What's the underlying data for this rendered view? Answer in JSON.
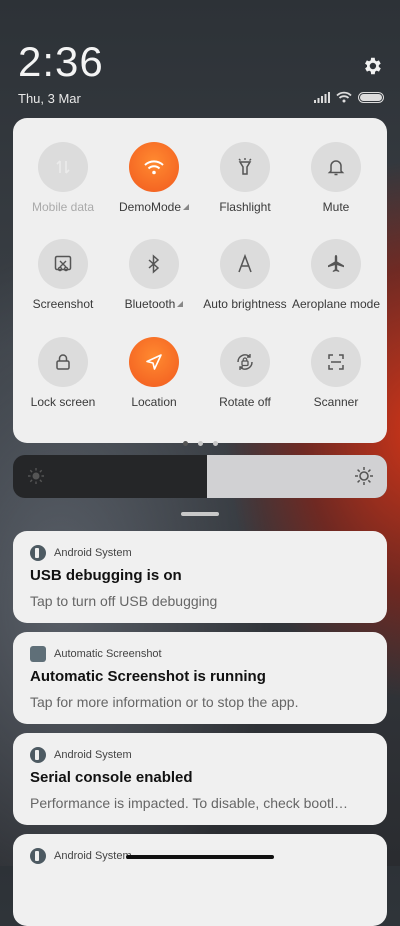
{
  "header": {
    "time": "2:36",
    "date": "Thu, 3 Mar"
  },
  "quick_settings": {
    "tiles": [
      {
        "label": "Mobile data",
        "icon": "mobile-data-icon",
        "state": "disabled"
      },
      {
        "label": "DemoMode",
        "icon": "wifi-icon",
        "state": "on"
      },
      {
        "label": "Flashlight",
        "icon": "flashlight-icon",
        "state": "off"
      },
      {
        "label": "Mute",
        "icon": "bell-icon",
        "state": "off"
      },
      {
        "label": "Screenshot",
        "icon": "screenshot-icon",
        "state": "off"
      },
      {
        "label": "Bluetooth",
        "icon": "bluetooth-icon",
        "state": "off"
      },
      {
        "label": "Auto brightness",
        "icon": "auto-brightness-icon",
        "state": "off"
      },
      {
        "label": "Aeroplane mode",
        "icon": "airplane-icon",
        "state": "off"
      },
      {
        "label": "Lock screen",
        "icon": "lock-icon",
        "state": "off"
      },
      {
        "label": "Location",
        "icon": "location-icon",
        "state": "on"
      },
      {
        "label": "Rotate off",
        "icon": "rotate-lock-icon",
        "state": "off"
      },
      {
        "label": "Scanner",
        "icon": "scanner-icon",
        "state": "off"
      }
    ],
    "page_count": 3,
    "active_page": 1
  },
  "brightness": {
    "level": 0.48
  },
  "notifications": [
    {
      "app": "Android System",
      "title": "USB debugging is on",
      "body": "Tap to turn off USB debugging"
    },
    {
      "app": "Automatic Screenshot",
      "title": "Automatic Screenshot is running",
      "body": "Tap for more information or to stop the app."
    },
    {
      "app": "Android System",
      "title": "Serial console enabled",
      "body": "Performance is impacted. To disable, check bootl…"
    },
    {
      "app": "Android System",
      "title": "",
      "body": ""
    }
  ],
  "colors": {
    "accent": "#f26522",
    "panel": "#efefef"
  }
}
